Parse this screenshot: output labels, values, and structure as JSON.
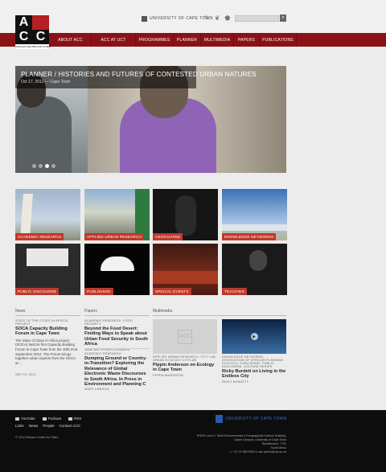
{
  "header": {
    "logo": {
      "letters": [
        "A",
        "C",
        "C",
        ""
      ],
      "subtitle": "AFRICAN CENTRE FOR CITIES"
    },
    "university": "UNIVERSITY OF CAPE TOWN",
    "social_icons": [
      "ucl-icon",
      "leaf-icon",
      "africa-icon"
    ],
    "search": {
      "placeholder": "",
      "button": "⌕"
    }
  },
  "nav": {
    "items": [
      {
        "label": "ABOUT ACC"
      },
      {
        "label": "ACC AT UCT"
      },
      {
        "label": "PROGRAMMES"
      },
      {
        "label": "PLANNER"
      },
      {
        "label": "MULTIMEDIA"
      },
      {
        "label": "PAPERS"
      },
      {
        "label": "PUBLICATIONS"
      }
    ]
  },
  "hero": {
    "title": "PLANNER / HISTORIES AND FUTURES OF CONTESTED URBAN NATURES",
    "meta": "Oct 17, 2012 — Cape Town",
    "slides": 4,
    "active_slide": 3
  },
  "tiles": [
    {
      "label": "ACADEMIC RESEARCH"
    },
    {
      "label": "APPLIED URBAN RESEARCH"
    },
    {
      "label": "ASSOCIATED"
    },
    {
      "label": "KNOWLEDGE NETWORKS"
    },
    {
      "label": "PUBLIC DISCOURSE"
    },
    {
      "label": "PUBLISHING"
    },
    {
      "label": "SPECIAL EVENTS"
    },
    {
      "label": "TEACHING"
    }
  ],
  "news": {
    "heading": "News",
    "category": "STATE OF THE CITIES IN AFRICA PROJECT",
    "title": "SOCA Capacity Building Forum in Cape Town",
    "body": "The State of Cities in Africa project (SOCA) held its first Capacity Building Forum in Cape Town from the  20th-21st September 2012. The Forum brings together urban experts from the SOCA ar...",
    "date": "SEP 20, 2012"
  },
  "papers": {
    "heading": "Papers",
    "items": [
      {
        "category": "ACADEMIC RESEARCH, FOOD SECURITY",
        "title": "Beyond the Food Desert: Finding Ways to Speak about Urban Food Security in South Africa",
        "author": "JANE BATTERSBY-LENNARD"
      },
      {
        "category": "ACADEMIC RESEARCH",
        "title": "Dumping Ground or Country-in-Transition? Exploring the Relevance of Global Electronic Waste Discourses to South Africa. In Press in Environment and Planning C",
        "author": "MARY LAWHON"
      }
    ]
  },
  "multimedia": {
    "heading": "Multimedia",
    "items": [
      {
        "category": "APPLIED URBAN RESEARCH, CITY LAB, URBAN ECOLOGY CITYLAB",
        "title": "Pippin Anderson on Ecology in Cape Town",
        "author": "PIPPIN ANDERSON"
      },
      {
        "category": "KNOWLEDGE NETWORKS, ASSOCIATION OF AFRICAN PLANNING SCHOOLS, PUBLISHING, PUBLIC DISCOURSE, LECTURE SERIES",
        "title": "Ricky Burdett on Living in the Endless City",
        "author": "RICKY BURDETT"
      }
    ]
  },
  "footer": {
    "social": [
      "YouTube",
      "Podcast",
      "RSS"
    ],
    "links": [
      "Links",
      "News",
      "People",
      "Contact ACC"
    ],
    "copyright": "© 2012 African Centre for Cities",
    "university": "UNIVERSITY OF CAPE TOWN",
    "address": [
      "ENGE Level 2, Shell Environmental & Geographical Science Building,",
      "Upper Campus, University of Cape Town",
      "Rondebosch, 7701",
      "South Africa",
      "t: +27 21 650 5903   e: acc.admin@uct.ac.za"
    ]
  },
  "colors": {
    "brand_red": "#b61f24",
    "nav_band": "#8a1216",
    "tile_label": "#c0392b"
  }
}
